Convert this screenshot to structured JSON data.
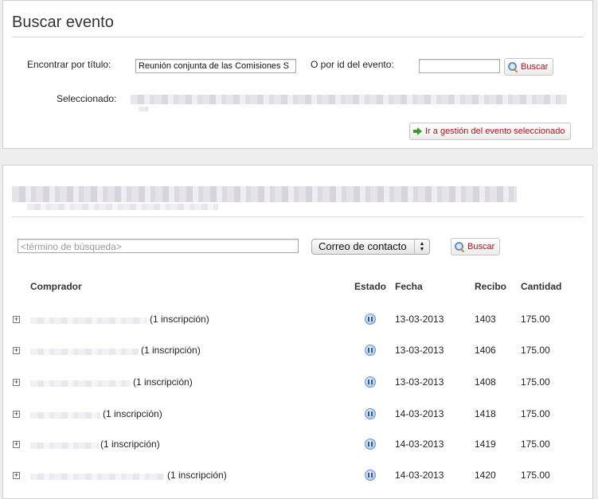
{
  "search_event": {
    "title": "Buscar evento",
    "find_by_title_label": "Encontrar por título:",
    "title_input_value": "Reunión conjunta de las Comisiones S",
    "by_id_label": "O por id del evento:",
    "id_input_value": "",
    "search_button_label": "Buscar",
    "selected_label": "Seleccionado:",
    "go_to_event_button_label": "Ir a gestión del evento seleccionado"
  },
  "buyers": {
    "search_placeholder": "<término de búsqueda>",
    "field_select_value": "Correo de contacto",
    "search_button_label": "Buscar",
    "columns": {
      "buyer": "Comprador",
      "status": "Estado",
      "date": "Fecha",
      "receipt": "Recibo",
      "amount": "Cantidad"
    },
    "rows": [
      {
        "registrations": "(1 inscripción)",
        "date": "13-03-2013",
        "receipt": "1403",
        "amount": "175.00"
      },
      {
        "registrations": "(1 inscripción)",
        "date": "13-03-2013",
        "receipt": "1406",
        "amount": "175.00"
      },
      {
        "registrations": "(1 inscripción)",
        "date": "13-03-2013",
        "receipt": "1408",
        "amount": "175.00"
      },
      {
        "registrations": "(1 inscripción)",
        "date": "14-03-2013",
        "receipt": "1418",
        "amount": "175.00"
      },
      {
        "registrations": "(1 inscripción)",
        "date": "14-03-2013",
        "receipt": "1419",
        "amount": "175.00"
      },
      {
        "registrations": "(1 inscripción)",
        "date": "14-03-2013",
        "receipt": "1420",
        "amount": "175.00"
      }
    ]
  },
  "colors": {
    "accent_text": "#b3121b",
    "status_icon": "#6f96c9"
  },
  "icons": {
    "search": "magnifier-icon",
    "go": "green-arrow-icon",
    "expand": "plus-icon",
    "status": "pause-icon"
  }
}
